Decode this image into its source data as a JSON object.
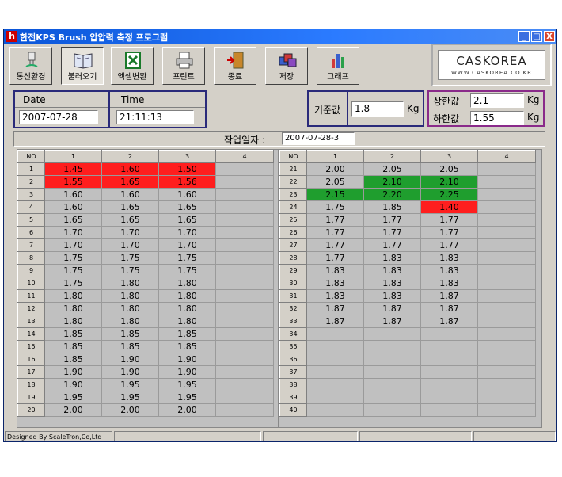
{
  "window": {
    "title": "한전KPS Brush 압압력 측정 프로그램",
    "app_icon": "h",
    "controls": {
      "minimize": "_",
      "maximize": "□",
      "close": "X"
    }
  },
  "toolbar": {
    "buttons": [
      {
        "label": "통신환경",
        "icon": "plug-icon"
      },
      {
        "label": "불러오기",
        "icon": "book-icon"
      },
      {
        "label": "엑셀변환",
        "icon": "excel-icon"
      },
      {
        "label": "프린트",
        "icon": "printer-icon"
      },
      {
        "label": "종료",
        "icon": "exit-door-icon"
      },
      {
        "label": "저장",
        "icon": "save-icon"
      },
      {
        "label": "그래프",
        "icon": "chart-icon"
      }
    ]
  },
  "logo": {
    "name": "CASKOREA",
    "url": "WWW.CASKOREA.CO.KR"
  },
  "info": {
    "date_label": "Date",
    "date_value": "2007-07-28",
    "time_label": "Time",
    "time_value": "21:11:13"
  },
  "reference": {
    "label": "기준값",
    "value": "1.8",
    "unit": "Kg"
  },
  "limits": {
    "upper_label": "상한값",
    "upper_value": "2.1",
    "upper_unit": "Kg",
    "lower_label": "하한값",
    "lower_value": "1.55",
    "lower_unit": "Kg"
  },
  "work": {
    "label": "작업일자 :",
    "value": "2007-07-28-3"
  },
  "colors": {
    "above_upper": "#ff1e1e",
    "below_lower": "#ff1e1e",
    "warning": "#1f9e2e"
  },
  "tables": [
    {
      "headers": [
        "NO",
        "1",
        "2",
        "3",
        "4"
      ],
      "rows": [
        [
          "1",
          "1.45",
          "1.60",
          "1.50",
          ""
        ],
        [
          "2",
          "1.55",
          "1.65",
          "1.56",
          ""
        ],
        [
          "3",
          "1.60",
          "1.60",
          "1.60",
          ""
        ],
        [
          "4",
          "1.60",
          "1.65",
          "1.65",
          ""
        ],
        [
          "5",
          "1.65",
          "1.65",
          "1.65",
          ""
        ],
        [
          "6",
          "1.70",
          "1.70",
          "1.70",
          ""
        ],
        [
          "7",
          "1.70",
          "1.70",
          "1.70",
          ""
        ],
        [
          "8",
          "1.75",
          "1.75",
          "1.75",
          ""
        ],
        [
          "9",
          "1.75",
          "1.75",
          "1.75",
          ""
        ],
        [
          "10",
          "1.75",
          "1.80",
          "1.80",
          ""
        ],
        [
          "11",
          "1.80",
          "1.80",
          "1.80",
          ""
        ],
        [
          "12",
          "1.80",
          "1.80",
          "1.80",
          ""
        ],
        [
          "13",
          "1.80",
          "1.80",
          "1.80",
          ""
        ],
        [
          "14",
          "1.85",
          "1.85",
          "1.85",
          ""
        ],
        [
          "15",
          "1.85",
          "1.85",
          "1.85",
          ""
        ],
        [
          "16",
          "1.85",
          "1.90",
          "1.90",
          ""
        ],
        [
          "17",
          "1.90",
          "1.90",
          "1.90",
          ""
        ],
        [
          "18",
          "1.90",
          "1.95",
          "1.95",
          ""
        ],
        [
          "19",
          "1.95",
          "1.95",
          "1.95",
          ""
        ],
        [
          "20",
          "2.00",
          "2.00",
          "2.00",
          ""
        ]
      ],
      "highlights": {
        "0": {
          "1": "red",
          "2": "red",
          "3": "red"
        },
        "1": {
          "1": "red",
          "2": "red",
          "3": "red"
        }
      }
    },
    {
      "headers": [
        "NO",
        "1",
        "2",
        "3",
        "4"
      ],
      "rows": [
        [
          "21",
          "2.00",
          "2.05",
          "2.05",
          ""
        ],
        [
          "22",
          "2.05",
          "2.10",
          "2.10",
          ""
        ],
        [
          "23",
          "2.15",
          "2.20",
          "2.25",
          ""
        ],
        [
          "24",
          "1.75",
          "1.85",
          "1.40",
          ""
        ],
        [
          "25",
          "1.77",
          "1.77",
          "1.77",
          ""
        ],
        [
          "26",
          "1.77",
          "1.77",
          "1.77",
          ""
        ],
        [
          "27",
          "1.77",
          "1.77",
          "1.77",
          ""
        ],
        [
          "28",
          "1.77",
          "1.83",
          "1.83",
          ""
        ],
        [
          "29",
          "1.83",
          "1.83",
          "1.83",
          ""
        ],
        [
          "30",
          "1.83",
          "1.83",
          "1.83",
          ""
        ],
        [
          "31",
          "1.83",
          "1.83",
          "1.87",
          ""
        ],
        [
          "32",
          "1.87",
          "1.87",
          "1.87",
          ""
        ],
        [
          "33",
          "1.87",
          "1.87",
          "1.87",
          ""
        ],
        [
          "34",
          "",
          "",
          "",
          ""
        ],
        [
          "35",
          "",
          "",
          "",
          ""
        ],
        [
          "36",
          "",
          "",
          "",
          ""
        ],
        [
          "37",
          "",
          "",
          "",
          ""
        ],
        [
          "38",
          "",
          "",
          "",
          ""
        ],
        [
          "39",
          "",
          "",
          "",
          ""
        ],
        [
          "40",
          "",
          "",
          "",
          ""
        ]
      ],
      "highlights": {
        "1": {
          "2": "green",
          "3": "green"
        },
        "2": {
          "1": "green",
          "2": "green",
          "3": "green"
        },
        "3": {
          "3": "red"
        }
      }
    }
  ],
  "status": {
    "credit": "Designed By ScaleTron,Co,Ltd"
  }
}
